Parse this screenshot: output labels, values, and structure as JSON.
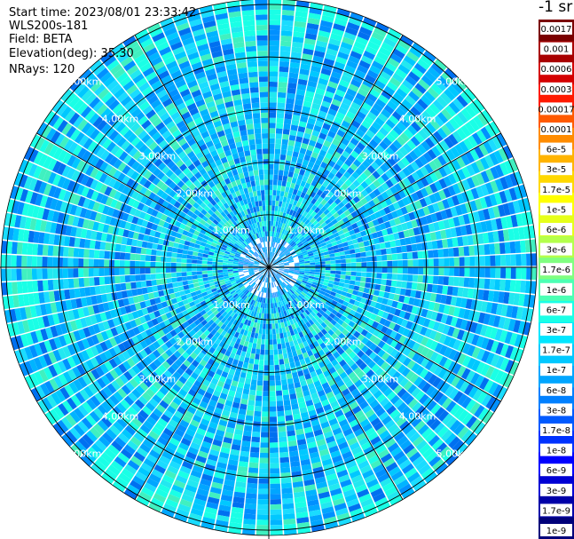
{
  "header": {
    "start_time": "Start time: 2023/08/01 23:33:42",
    "instrument": "WLS200s-181",
    "field": "Field: BETA",
    "elevation": "Elevation(deg): 35.30",
    "nrays": "NRays: 120"
  },
  "colorbar": {
    "title": "-1 sr",
    "labels": [
      "0.0017",
      "0.001",
      "0.0006",
      "0.0003",
      "0.00017",
      "0.0001",
      "6e-5",
      "3e-5",
      "1.7e-5",
      "1e-5",
      "6e-6",
      "3e-6",
      "1.7e-6",
      "1e-6",
      "6e-7",
      "3e-7",
      "1.7e-7",
      "1e-7",
      "6e-8",
      "3e-8",
      "1.7e-8",
      "1e-8",
      "6e-9",
      "3e-9",
      "1.7e-9",
      "1e-9"
    ],
    "colors": [
      "#7a0000",
      "#a80000",
      "#d40000",
      "#ff1a00",
      "#ff5a00",
      "#ff8c00",
      "#ffb400",
      "#ffd800",
      "#ffff00",
      "#e6ff1a",
      "#b4ff4c",
      "#80ff80",
      "#4cffb4",
      "#1affe6",
      "#00e6ff",
      "#00c8ff",
      "#00a6ff",
      "#0080ff",
      "#005aff",
      "#0032ff",
      "#0000ff",
      "#0000d4",
      "#0000a8",
      "#00007a"
    ]
  },
  "chart_data": {
    "type": "heatmap",
    "projection": "polar (PPI scan)",
    "range_ring_labels": [
      "1.00km",
      "2.00km",
      "3.00km",
      "4.00km",
      "5.00km"
    ],
    "range_rings_km": [
      1,
      2,
      3,
      4,
      5
    ],
    "max_range_km": 5.1,
    "spokes_deg": [
      0,
      30,
      60,
      90,
      120,
      150,
      180,
      210,
      240,
      270,
      300,
      330
    ],
    "n_rays": 120,
    "n_gates": 52,
    "dominant_colors": [
      "#00c8ff",
      "#00a6ff",
      "#1affe6",
      "#0080ff"
    ]
  }
}
